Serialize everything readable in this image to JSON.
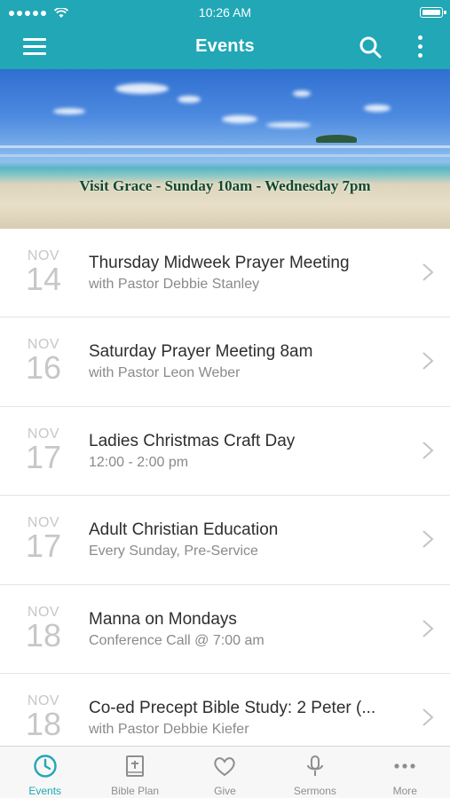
{
  "status_bar": {
    "time": "10:26 AM"
  },
  "nav": {
    "title": "Events"
  },
  "banner": {
    "caption": "Visit Grace - Sunday 10am - Wednesday 7pm"
  },
  "events": [
    {
      "month": "NOV",
      "day": "14",
      "title": "Thursday Midweek Prayer Meeting",
      "subtitle": "with Pastor Debbie Stanley"
    },
    {
      "month": "NOV",
      "day": "16",
      "title": "Saturday Prayer Meeting 8am",
      "subtitle": "with Pastor Leon Weber"
    },
    {
      "month": "NOV",
      "day": "17",
      "title": "Ladies Christmas Craft Day",
      "subtitle": "12:00 - 2:00 pm"
    },
    {
      "month": "NOV",
      "day": "17",
      "title": "Adult Christian Education",
      "subtitle": "Every Sunday, Pre-Service"
    },
    {
      "month": "NOV",
      "day": "18",
      "title": "Manna on Mondays",
      "subtitle": "Conference Call @ 7:00 am"
    },
    {
      "month": "NOV",
      "day": "18",
      "title": "Co-ed Precept Bible Study: 2 Peter  (...",
      "subtitle": "with Pastor Debbie Kiefer"
    }
  ],
  "tabs": [
    {
      "label": "Events",
      "icon": "clock-icon",
      "active": true
    },
    {
      "label": "Bible Plan",
      "icon": "bible-icon",
      "active": false
    },
    {
      "label": "Give",
      "icon": "heart-icon",
      "active": false
    },
    {
      "label": "Sermons",
      "icon": "microphone-icon",
      "active": false
    },
    {
      "label": "More",
      "icon": "more-dots-icon",
      "active": false
    }
  ],
  "colors": {
    "accent": "#21a7b6",
    "tab_inactive": "#8e8e8e",
    "date_gray": "#c7c7c7"
  }
}
